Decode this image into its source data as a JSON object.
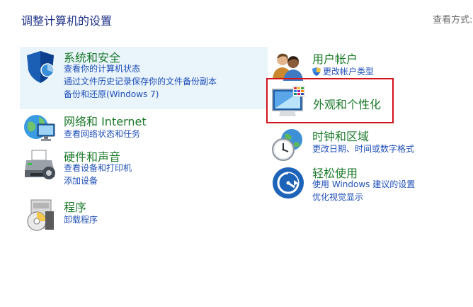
{
  "header": {
    "title": "调整计算机的设置",
    "view_by": "查看方式:"
  },
  "categories": {
    "system": {
      "icon": "security-shield-icon",
      "title": "系统和安全",
      "links": [
        "查看你的计算机状态",
        "通过文件历史记录保存你的文件备份副本",
        "备份和还原(Windows 7)"
      ]
    },
    "network": {
      "icon": "network-globe-icon",
      "title": "网络和 Internet",
      "links": [
        "查看网络状态和任务"
      ]
    },
    "hardware": {
      "icon": "printer-icon",
      "title": "硬件和声音",
      "links": [
        "查看设备和打印机",
        "添加设备"
      ]
    },
    "programs": {
      "icon": "programs-disc-icon",
      "title": "程序",
      "links": [
        "卸载程序"
      ]
    },
    "users": {
      "icon": "users-icon",
      "title": "用户帐户",
      "links": [
        "更改帐户类型"
      ]
    },
    "appearance": {
      "icon": "appearance-monitor-icon",
      "title": "外观和个性化",
      "highlight_color": "#d4121a"
    },
    "clock": {
      "icon": "clock-globe-icon",
      "title": "时钟和区域",
      "links": [
        "更改日期、时间或数字格式"
      ]
    },
    "ease": {
      "icon": "ease-of-access-icon",
      "title": "轻松使用",
      "links": [
        "使用 Windows 建议的设置",
        "优化视觉显示"
      ]
    }
  },
  "colors": {
    "category_title": "#1c7a2b",
    "link": "#1f4fb8",
    "selected_background": "#e9f4fb",
    "page_title": "#1e3287"
  }
}
